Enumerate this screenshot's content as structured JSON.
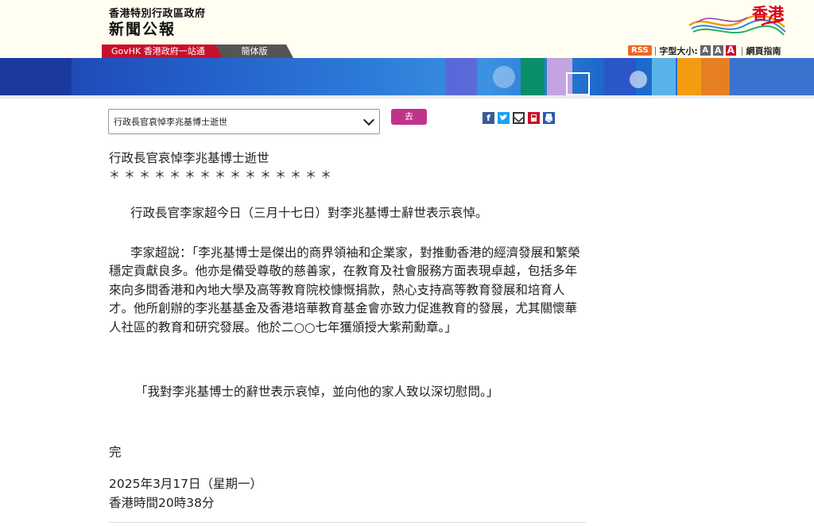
{
  "header": {
    "gov_name": "香港特別行政區政府",
    "press_title": "新聞公報",
    "logo_text": "香港"
  },
  "nav": {
    "govhk": "GovHK 香港政府一站通",
    "simplified": "簡体版",
    "rss": "RSS",
    "font_size_label": "字型大小:",
    "font_buttons": [
      "A",
      "A",
      "A"
    ],
    "sitemap": "網頁指南"
  },
  "selector": {
    "selected": "行政長官哀悼李兆基博士逝世",
    "go_label": "去"
  },
  "share_icons": [
    "facebook-icon",
    "twitter-icon",
    "email-icon",
    "save-icon",
    "print-icon"
  ],
  "article": {
    "title": "行政長官哀悼李兆基博士逝世",
    "stars": "＊＊＊＊＊＊＊＊＊＊＊＊＊＊＊",
    "para1": "行政長官李家超今日（三月十七日）對李兆基博士辭世表示哀悼。",
    "para2": "李家超說：「李兆基博士是傑出的商界領袖和企業家，對推動香港的經濟發展和繁榮穩定貢獻良多。他亦是備受尊敬的慈善家，在教育及社會服務方面表現卓越，包括多年來向多間香港和內地大學及高等教育院校慷慨捐款，熱心支持高等教育發展和培育人才。他所創辦的李兆基基金及香港培華教育基金會亦致力促進教育的發展，尤其關懷華人社區的教育和研究發展。他於二○○七年獲頒授大紫荊勳章。」",
    "para3": "「我對李兆基博士的辭世表示哀悼，並向他的家人致以深切慰問。」",
    "end": "完",
    "date": "2025年3月17日（星期一）",
    "time": "香港時間20時38分"
  },
  "colors": {
    "govhk_red": "#c8102e",
    "go_button": "#c0338a",
    "banner_blue": "#2360c9"
  }
}
